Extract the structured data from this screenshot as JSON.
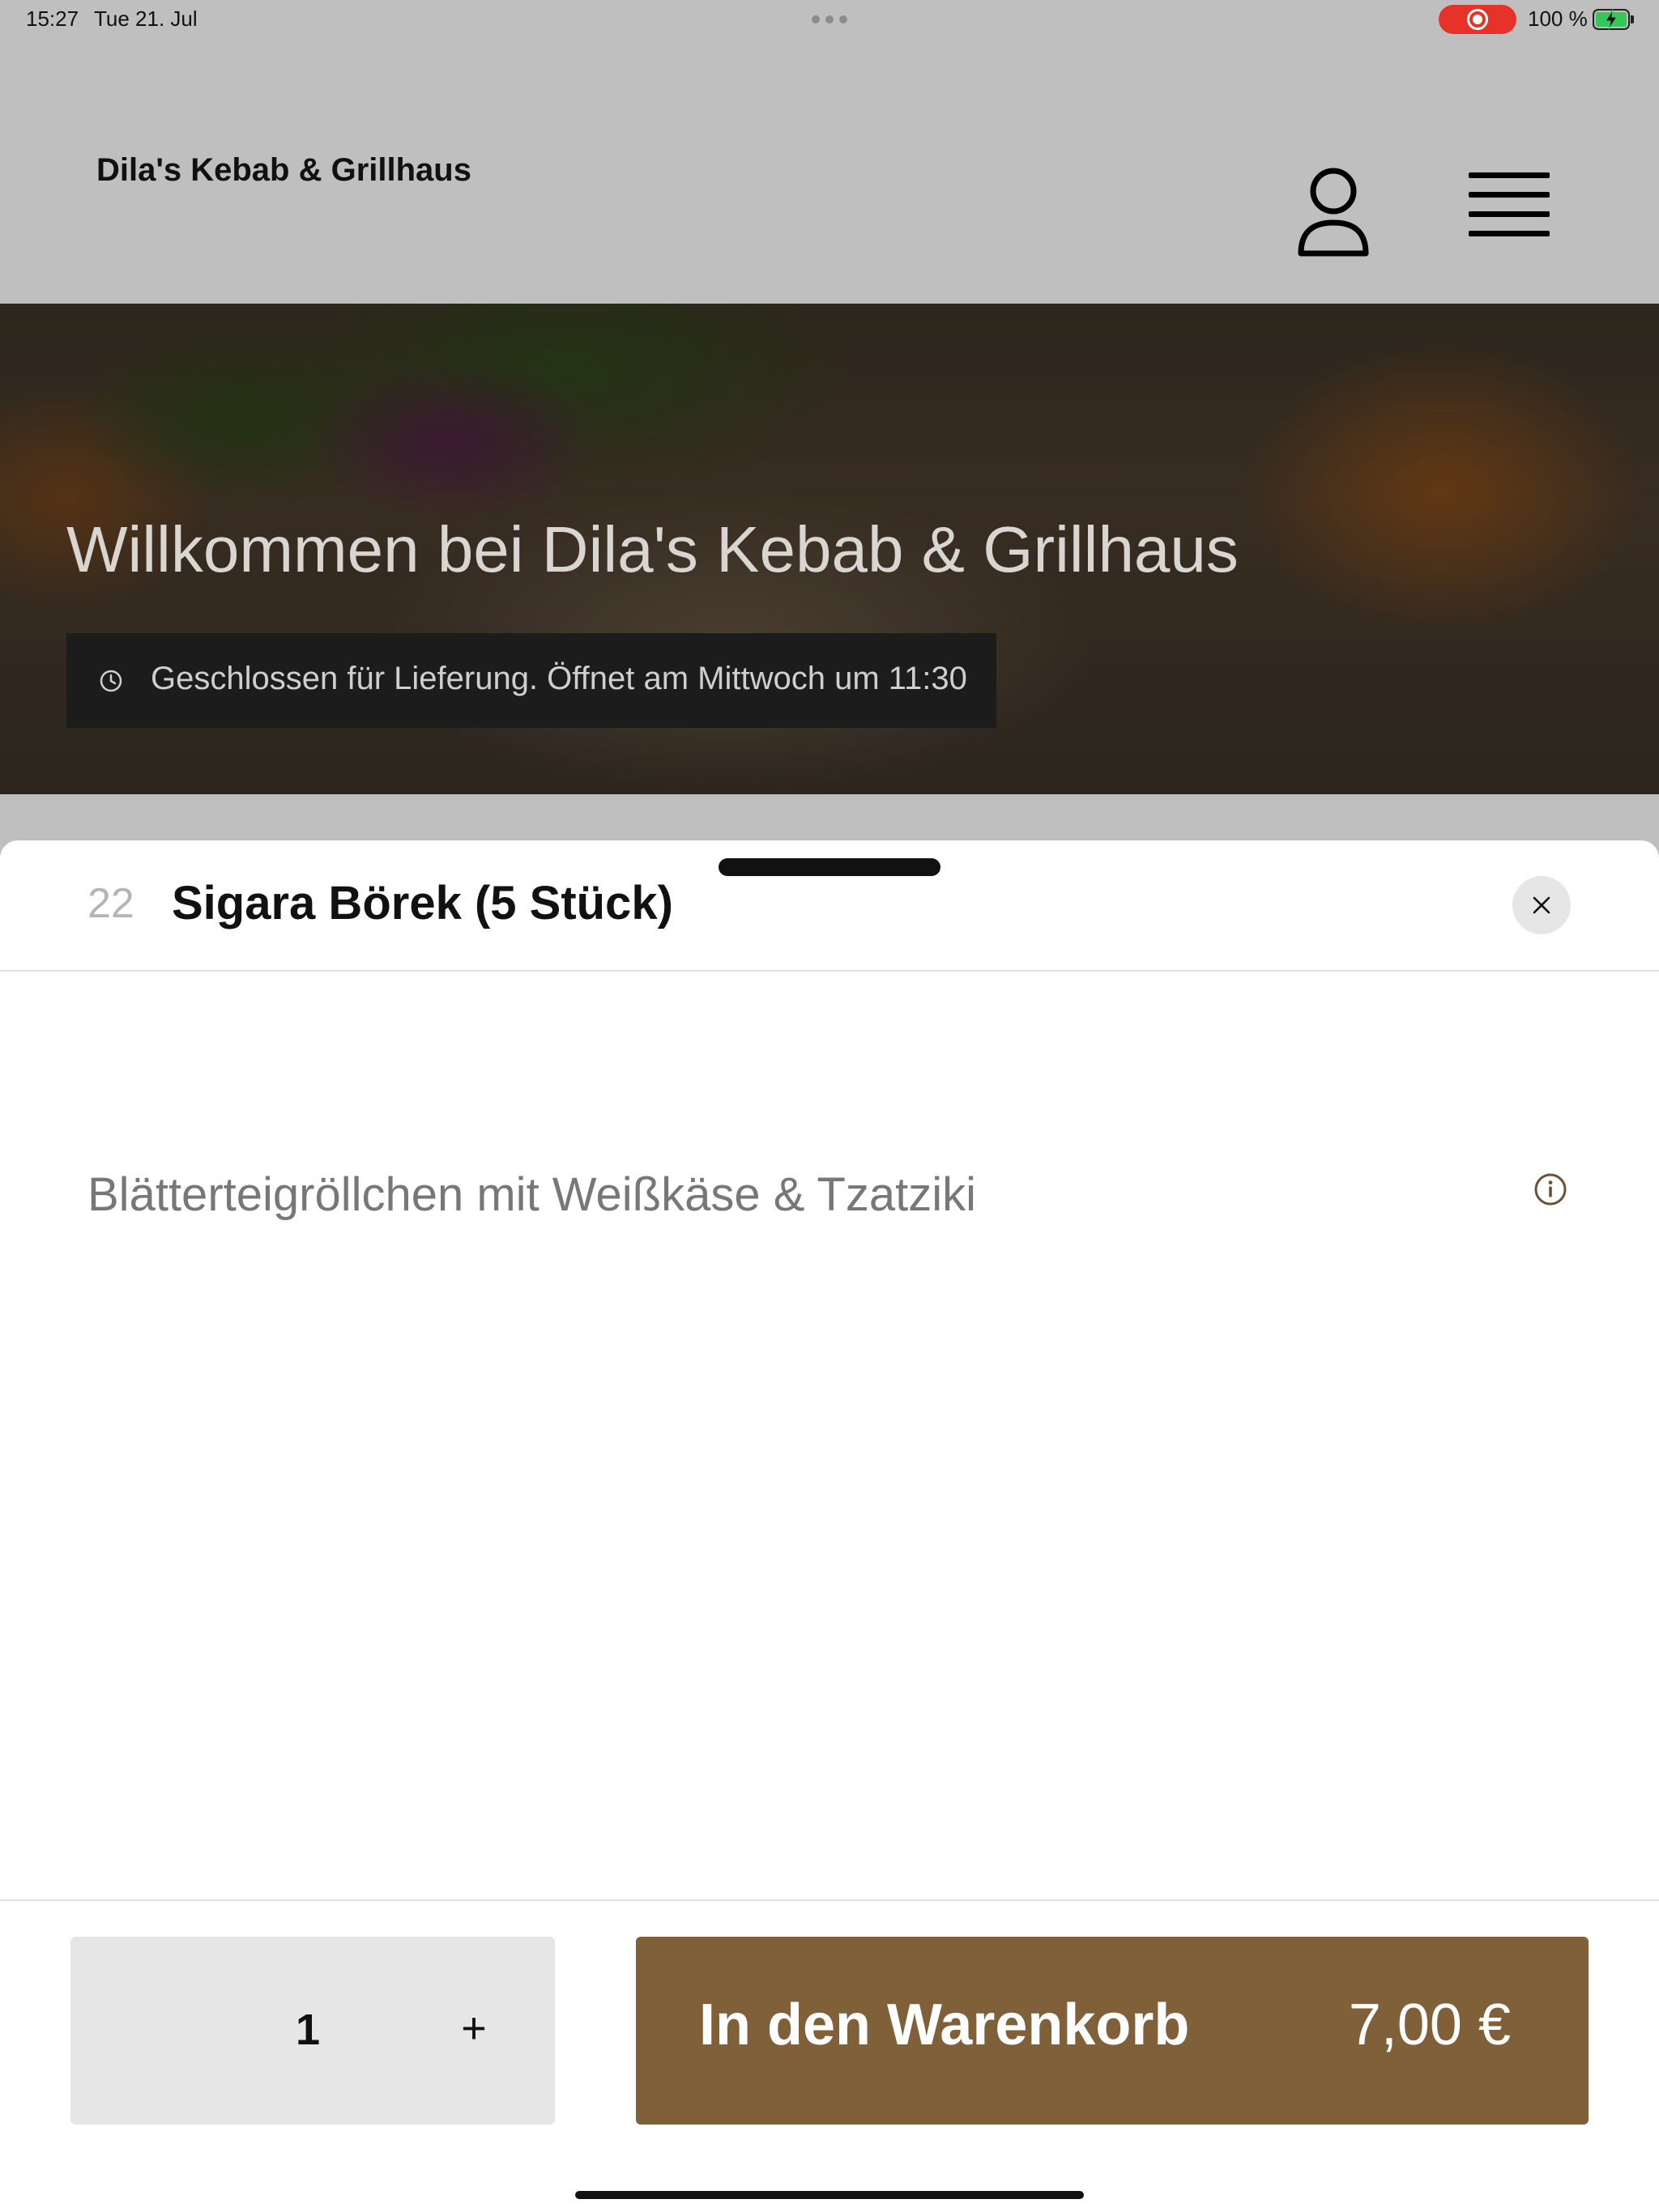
{
  "status_bar": {
    "time": "15:27",
    "date": "Tue 21. Jul",
    "battery_percent": "100 %",
    "battery_level": 1.0,
    "charging": true,
    "screen_recording": true,
    "colors": {
      "recording": "#e63228",
      "battery": "#34c759"
    }
  },
  "header": {
    "site_title": "Dila's Kebab & Grillhaus",
    "icons": {
      "account": "user-icon",
      "menu": "hamburger-menu-icon"
    }
  },
  "hero": {
    "title": "Willkommen bei Dila's Kebab & Grillhaus",
    "status_icon": "clock-icon",
    "status_text": "Geschlossen für Lieferung. Öffnet am Mittwoch um 11:30"
  },
  "item_sheet": {
    "number": "22",
    "title": "Sigara Börek (5 Stück)",
    "close_icon": "close-icon",
    "description": "Blätterteigröllchen mit Weißkäse & Tzatziki",
    "info_icon": "info-icon",
    "quantity": "1",
    "increment_label": "+",
    "add_to_cart_label": "In den Warenkorb",
    "price": "7,00 €",
    "colors": {
      "accent": "#806039",
      "info_icon": "#6b5234"
    }
  }
}
